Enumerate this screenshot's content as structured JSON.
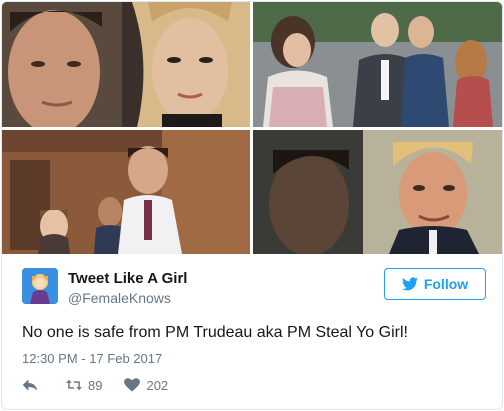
{
  "tweet": {
    "display_name": "Tweet Like A Girl",
    "handle": "@FemaleKnows",
    "follow_label": "Follow",
    "text": "No one is safe from PM Trudeau aka PM Steal Yo Girl!",
    "timestamp": "12:30 PM - 17 Feb 2017",
    "retweet_count": "89",
    "like_count": "202"
  },
  "media": [
    {
      "name": "photo-1"
    },
    {
      "name": "photo-2"
    },
    {
      "name": "photo-3"
    },
    {
      "name": "photo-4"
    }
  ],
  "colors": {
    "accent": "#1da1f2",
    "text": "#14171a",
    "muted": "#657786",
    "border": "#e1e8ed"
  },
  "icons": {
    "follow": "twitter-bird-icon",
    "reply": "reply-icon",
    "retweet": "retweet-icon",
    "like": "heart-icon"
  }
}
